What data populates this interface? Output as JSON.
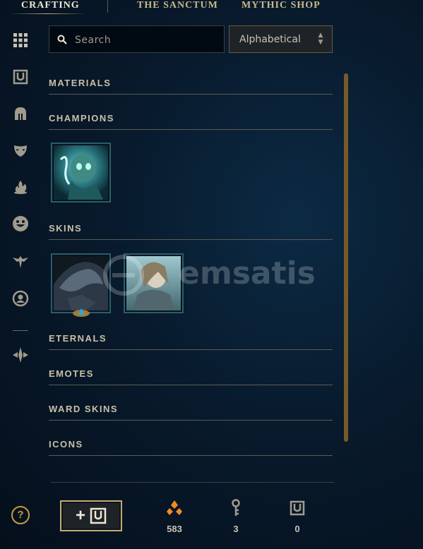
{
  "nav": {
    "tabs": [
      {
        "label": "CRAFTING",
        "active": true
      },
      {
        "label": "THE SANCTUM",
        "active": false
      },
      {
        "label": "MYTHIC SHOP",
        "active": false
      }
    ]
  },
  "sidebar": {
    "icons": [
      "grid-icon",
      "chest-icon",
      "helmet-icon",
      "mask-icon",
      "flame-icon",
      "emote-icon",
      "ward-icon",
      "profile-icon",
      "crystal-icon"
    ]
  },
  "search": {
    "placeholder": "Search",
    "value": ""
  },
  "sort": {
    "selected": "Alphabetical"
  },
  "sections": [
    {
      "title": "MATERIALS"
    },
    {
      "title": "CHAMPIONS"
    },
    {
      "title": "SKINS"
    },
    {
      "title": "ETERNALS"
    },
    {
      "title": "EMOTES"
    },
    {
      "title": "WARD SKINS"
    },
    {
      "title": "ICONS"
    }
  ],
  "watermark": {
    "text": "emsatis"
  },
  "bottom": {
    "help_label": "?",
    "add_button_plus": "+",
    "currencies": [
      {
        "icon": "orange-essence-icon",
        "value": "583"
      },
      {
        "icon": "key-icon",
        "value": "3"
      },
      {
        "icon": "chest-icon",
        "value": "0"
      }
    ]
  },
  "colors": {
    "accent_gold": "#c8aa6e",
    "tile_border": "#2a5e6a",
    "background": "#081a2c"
  }
}
